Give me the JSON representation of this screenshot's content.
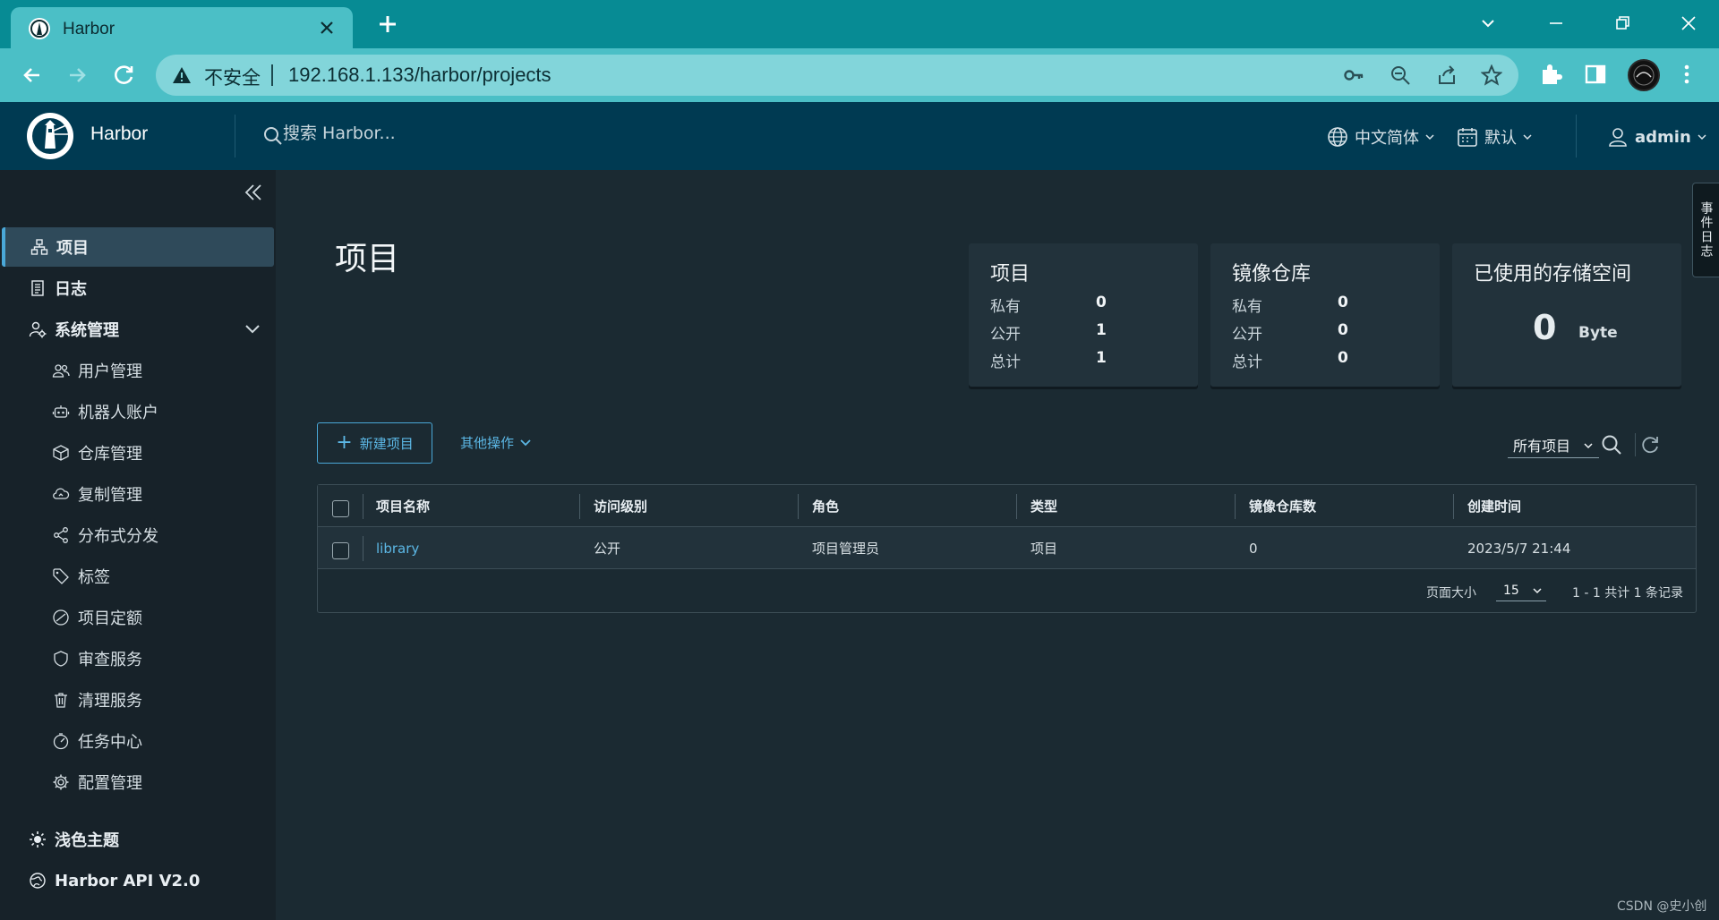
{
  "browser": {
    "tab_title": "Harbor",
    "security_label": "不安全",
    "url": "192.168.1.133/harbor/projects"
  },
  "header": {
    "brand": "Harbor",
    "search_placeholder": "搜索 Harbor...",
    "language": "中文简体",
    "date_format": "默认",
    "user": "admin"
  },
  "sidebar": {
    "items": [
      {
        "label": "项目",
        "icon": "projects-icon",
        "active": true
      },
      {
        "label": "日志",
        "icon": "logs-icon"
      },
      {
        "label": "系统管理",
        "icon": "admin-icon"
      }
    ],
    "admin_items": [
      {
        "label": "用户管理",
        "icon": "users-icon"
      },
      {
        "label": "机器人账户",
        "icon": "robot-icon"
      },
      {
        "label": "仓库管理",
        "icon": "registry-icon"
      },
      {
        "label": "复制管理",
        "icon": "replication-icon"
      },
      {
        "label": "分布式分发",
        "icon": "distribution-icon"
      },
      {
        "label": "标签",
        "icon": "tag-icon"
      },
      {
        "label": "项目定额",
        "icon": "quota-icon"
      },
      {
        "label": "审查服务",
        "icon": "shield-icon"
      },
      {
        "label": "清理服务",
        "icon": "trash-icon"
      },
      {
        "label": "任务中心",
        "icon": "dashboard-icon"
      },
      {
        "label": "配置管理",
        "icon": "gear-icon"
      }
    ],
    "theme": "浅色主题",
    "api": "Harbor API V2.0"
  },
  "main": {
    "title": "项目",
    "cards": {
      "projects": {
        "title": "项目",
        "private_label": "私有",
        "private": "0",
        "public_label": "公开",
        "public": "1",
        "total_label": "总计",
        "total": "1"
      },
      "repositories": {
        "title": "镜像仓库",
        "private_label": "私有",
        "private": "0",
        "public_label": "公开",
        "public": "0",
        "total_label": "总计",
        "total": "0"
      },
      "storage": {
        "title": "已使用的存储空间",
        "value": "0",
        "unit": "Byte"
      }
    },
    "new_project": "新建项目",
    "other_actions": "其他操作",
    "filter": "所有项目",
    "columns": [
      "项目名称",
      "访问级别",
      "角色",
      "类型",
      "镜像仓库数",
      "创建时间"
    ],
    "rows": [
      [
        "library",
        "公开",
        "项目管理员",
        "项目",
        "0",
        "2023/5/7 21:44"
      ]
    ],
    "page_size_label": "页面大小",
    "page_size": "15",
    "total_records": "1 - 1 共计 1 条记录"
  },
  "side_tab": "事件日志",
  "watermark": "CSDN @史小创"
}
